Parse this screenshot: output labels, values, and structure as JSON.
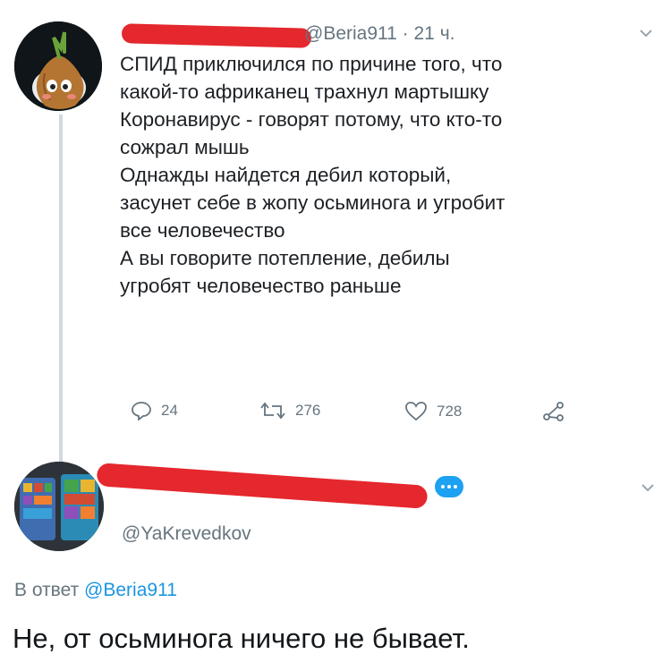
{
  "tweet": {
    "handle": "@Beria911",
    "time": "· 21 ч.",
    "lines": [
      "СПИД приключился  по причине того, что",
      "какой-то африканец трахнул мартышку",
      "Коронавирус - говорят потому, что кто-то",
      "сожрал мышь",
      "Однажды найдется дебил который,",
      "засунет себе в жопу осьминога и угробит",
      "все человечество",
      "А вы говорите потепление, дебилы",
      "угробят человечество раньше"
    ],
    "actions": {
      "replies": "24",
      "retweets": "276",
      "likes": "728"
    }
  },
  "reply": {
    "handle": "@YaKrevedkov",
    "reply_to_prefix": "В ответ",
    "reply_to_handle": "@Beria911",
    "text": "Не, от осьминога ничего не бывает."
  },
  "colors": {
    "text": "#1c2024",
    "muted": "#66757f",
    "link": "#1b95e0",
    "redaction": "#e4282d"
  },
  "icons": [
    "avatar-onion",
    "chevron-down-icon",
    "reply-icon",
    "retweet-icon",
    "like-icon",
    "share-icon",
    "avatar-phones"
  ]
}
